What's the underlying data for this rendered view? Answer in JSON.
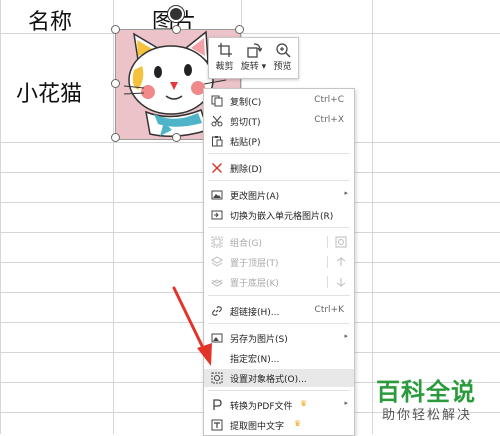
{
  "sheet": {
    "header_cells": [
      "名称",
      "图片"
    ],
    "row_cells": [
      "小花猫"
    ]
  },
  "mini_toolbar": [
    {
      "label": "裁剪",
      "icon": "crop-icon"
    },
    {
      "label": "旋转 ▾",
      "icon": "rotate-icon"
    },
    {
      "label": "预览",
      "icon": "zoom-preview-icon"
    }
  ],
  "context_menu": {
    "copy": {
      "label": "复制(C)",
      "shortcut": "Ctrl+C"
    },
    "cut": {
      "label": "剪切(T)",
      "shortcut": "Ctrl+X"
    },
    "paste": {
      "label": "粘贴(P)"
    },
    "delete": {
      "label": "删除(D)"
    },
    "change_picture": {
      "label": "更改图片(A)"
    },
    "switch_embed": {
      "label": "切换为嵌入单元格图片(R)"
    },
    "group": {
      "label": "组合(G)"
    },
    "bring_top": {
      "label": "置于顶层(T)"
    },
    "send_bottom": {
      "label": "置于底层(K)"
    },
    "hyperlink": {
      "label": "超链接(H)...",
      "shortcut": "Ctrl+K"
    },
    "save_as_picture": {
      "label": "另存为图片(S)"
    },
    "assign_macro": {
      "label": "指定宏(N)..."
    },
    "format_object": {
      "label": "设置对象格式(O)..."
    },
    "convert_pdf": {
      "label": "转换为PDF文件"
    },
    "extract_text": {
      "label": "提取图中文字"
    }
  },
  "watermark": {
    "logo": "百科全说",
    "subtitle": "助你轻松解决"
  },
  "colors": {
    "accent_arrow": "#e2352a",
    "watermark_green": "#2b9a3c",
    "delete_red": "#d9352b",
    "crown_orange": "#f5a623"
  }
}
